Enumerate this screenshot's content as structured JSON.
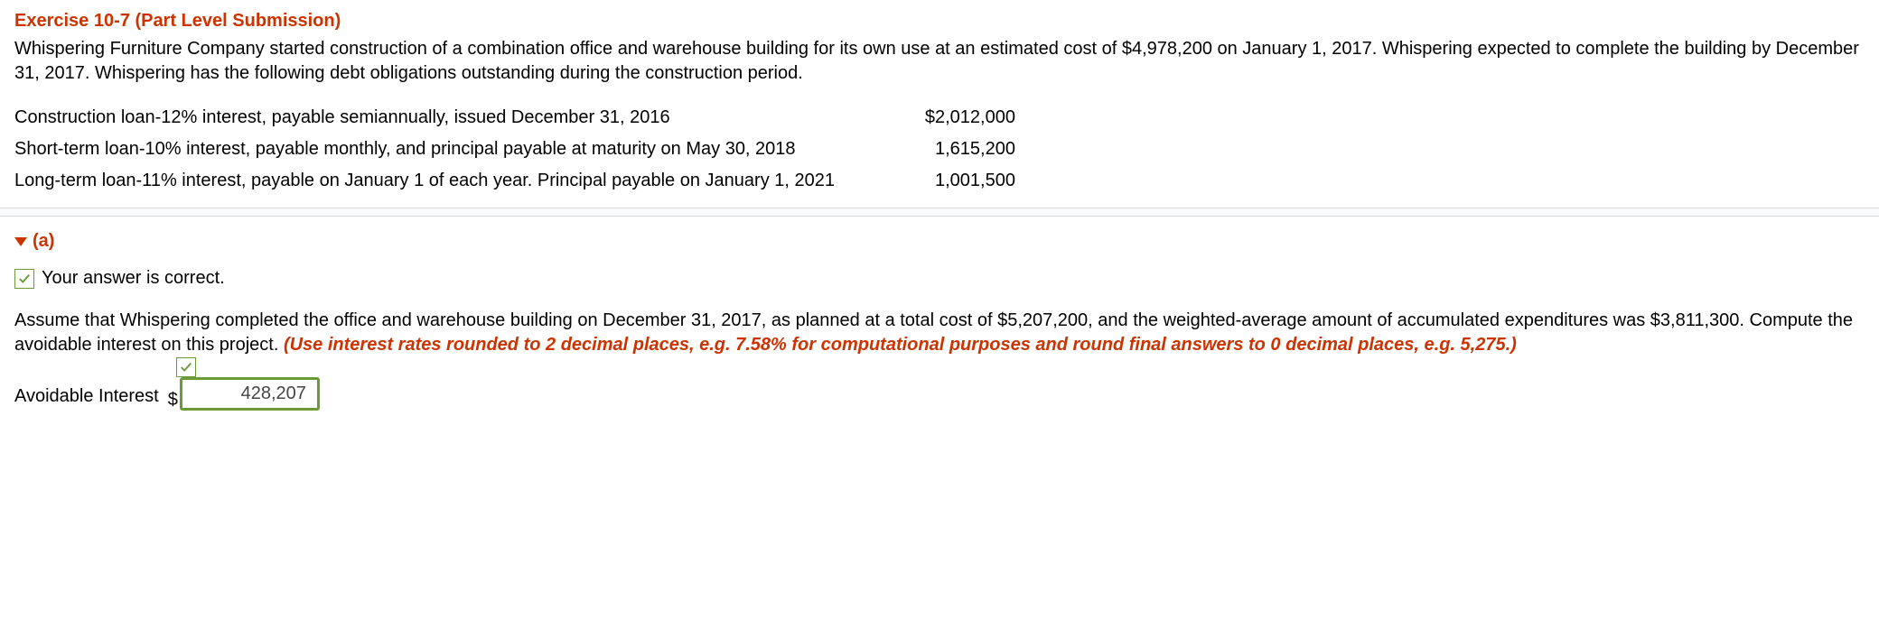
{
  "exercise": {
    "title": "Exercise 10-7 (Part Level Submission)",
    "intro": "Whispering Furniture Company started construction of a combination office and warehouse building for its own use at an estimated cost of $4,978,200 on January 1, 2017. Whispering expected to complete the building by December 31, 2017. Whispering has the following debt obligations outstanding during the construction period."
  },
  "debts": [
    {
      "desc": "Construction loan-12% interest, payable semiannually, issued December 31, 2016",
      "amount": "$2,012,000"
    },
    {
      "desc": "Short-term loan-10% interest, payable monthly, and principal payable at maturity on May 30, 2018",
      "amount": "1,615,200"
    },
    {
      "desc": "Long-term loan-11% interest, payable on January 1 of each  year. Principal payable on January 1, 2021",
      "amount": "1,001,500"
    }
  ],
  "part": {
    "label": "(a)"
  },
  "feedback": {
    "text": "Your answer is correct."
  },
  "assume": {
    "text": "Assume that Whispering completed the office and warehouse building on December 31, 2017, as planned at a total cost of $5,207,200, and the weighted-average amount of accumulated expenditures was $3,811,300. Compute the avoidable interest on this project. ",
    "instruction": "(Use interest rates rounded to 2 decimal places, e.g. 7.58% for computational purposes and round final answers to 0 decimal places, e.g. 5,275.)"
  },
  "answer": {
    "label": "Avoidable Interest",
    "currency": "$",
    "value": "428,207"
  }
}
